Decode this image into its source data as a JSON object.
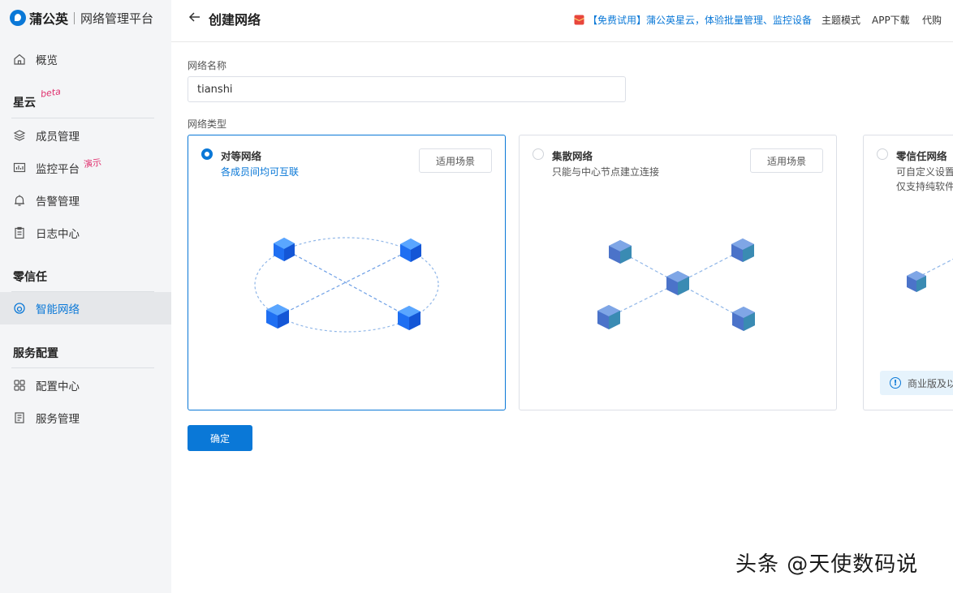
{
  "brand": {
    "name": "蒲公英",
    "subtitle": "网络管理平台"
  },
  "sidebar": {
    "overview": "概览",
    "sections": [
      {
        "title": "星云",
        "tag": "beta"
      },
      {
        "title": "零信任"
      },
      {
        "title": "服务配置"
      }
    ],
    "items": [
      {
        "label": "成员管理",
        "icon": "users-icon"
      },
      {
        "label": "监控平台",
        "icon": "monitor-icon",
        "tag": "演示"
      },
      {
        "label": "告警管理",
        "icon": "bell-icon"
      },
      {
        "label": "日志中心",
        "icon": "log-icon"
      },
      {
        "label": "智能网络",
        "icon": "smart-network-icon",
        "active": true
      },
      {
        "label": "配置中心",
        "icon": "grid-icon"
      },
      {
        "label": "服务管理",
        "icon": "service-icon"
      }
    ]
  },
  "header": {
    "title": "创建网络",
    "promo": "【免费试用】蒲公英星云，体验批量管理、监控设备",
    "links": [
      "主题模式",
      "APP下载",
      "代购"
    ]
  },
  "form": {
    "name_label": "网络名称",
    "name_value": "tianshi",
    "type_label": "网络类型",
    "scene_button": "适用场景",
    "types": [
      {
        "title": "对等网络",
        "desc": "各成员间均可互联",
        "selected": true
      },
      {
        "title": "集散网络",
        "desc": "只能与中心节点建立连接",
        "selected": false
      },
      {
        "title": "零信任网络",
        "desc": "可自定义设置",
        "desc2": "仅支持纯软件",
        "selected": false,
        "notice": "商业版及以"
      }
    ],
    "confirm": "确定"
  },
  "watermark": "头条 @天使数码说",
  "colors": {
    "accent": "#0a78d7",
    "sidebar_bg": "#f4f5f7",
    "promo_icon": "#e8463c"
  }
}
